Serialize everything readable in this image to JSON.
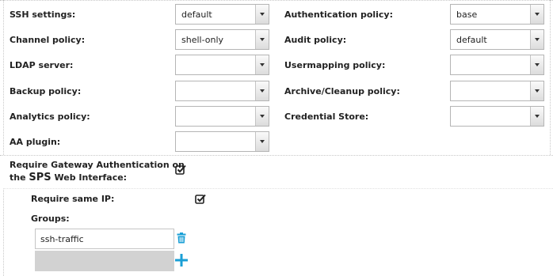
{
  "policies": {
    "ssh_settings": {
      "label": "SSH settings:",
      "value": "default"
    },
    "channel_policy": {
      "label": "Channel policy:",
      "value": "shell-only"
    },
    "ldap_server": {
      "label": "LDAP server:",
      "value": ""
    },
    "backup_policy": {
      "label": "Backup policy:",
      "value": ""
    },
    "analytics_policy": {
      "label": "Analytics policy:",
      "value": ""
    },
    "aa_plugin": {
      "label": "AA plugin:",
      "value": ""
    },
    "authentication_policy": {
      "label": "Authentication policy:",
      "value": "base"
    },
    "audit_policy": {
      "label": "Audit policy:",
      "value": "default"
    },
    "usermapping_policy": {
      "label": "Usermapping policy:",
      "value": ""
    },
    "archive_cleanup_policy": {
      "label": "Archive/Cleanup policy:",
      "value": ""
    },
    "credential_store": {
      "label": "Credential Store:",
      "value": ""
    }
  },
  "gateway_auth": {
    "label_line1": "Require Gateway Authentication on",
    "label_the": "the",
    "label_sps": "SPS",
    "label_tail": "Web Interface:",
    "checked": true
  },
  "require_same_ip": {
    "label": "Require same IP:",
    "checked": true
  },
  "groups": {
    "label": "Groups:",
    "items": [
      "ssh-traffic"
    ]
  },
  "icons": {
    "checkbox": "checkbox-checked-icon",
    "trash": "trash-icon",
    "add": "plus-icon"
  },
  "colors": {
    "accent": "#1a9fd6"
  }
}
